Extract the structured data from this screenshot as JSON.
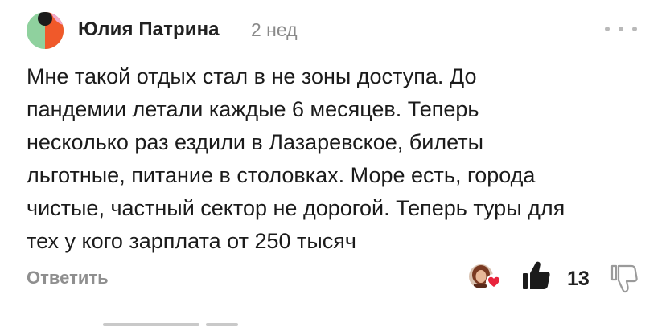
{
  "comment": {
    "author": "Юлия Патрина",
    "time": "2 нед",
    "text_lines": [
      "Мне такой отдых стал в не зоны доступа. До",
      "пандемии летали каждые 6 месяцев. Теперь",
      "несколько раз ездили в Лазаревское, билеты",
      "льготные, питание в столовках. Море есть, города",
      "чистые, частный сектор не дорогой. Теперь туры для",
      "тех у кого зарплата от 250 тысяч"
    ],
    "reply_label": "Ответить",
    "like_count": "13"
  },
  "icons": {
    "more": "more-dots-icon",
    "like": "thumbs-up-icon",
    "dislike": "thumbs-down-icon",
    "heart": "heart-icon"
  },
  "colors": {
    "avatar_green": "#8fd19e",
    "avatar_orange": "#f0592a",
    "avatar_pink": "#f2a7c8",
    "avatar_dark": "#1b1b1b",
    "heart": "#e8243c",
    "muted_text": "#8a8a8a"
  }
}
